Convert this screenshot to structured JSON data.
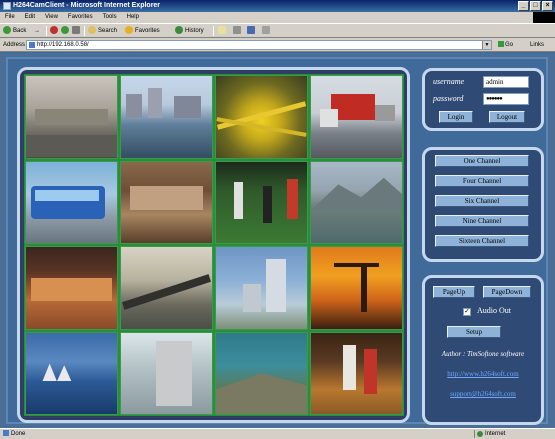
{
  "window": {
    "title": "H264CamClient - Microsoft Internet Explorer",
    "min": "_",
    "max": "□",
    "close": "×"
  },
  "menu": [
    "File",
    "Edit",
    "View",
    "Favorites",
    "Tools",
    "Help"
  ],
  "toolbar": {
    "back": "Back",
    "forward": "→",
    "search": "Search",
    "favorites": "Favorites",
    "history": "History"
  },
  "address": {
    "label": "Address",
    "url": "http://192.168.0.58/",
    "go": "Go",
    "links": "Links"
  },
  "login": {
    "username_label": "username",
    "username_value": "admin",
    "password_label": "password",
    "password_value": "●●●●●●",
    "login_button": "Login",
    "logout_button": "Logout"
  },
  "channels": [
    "One Channel",
    "Four Channel",
    "Six Channel",
    "Nine Channel",
    "Sixteen Channel"
  ],
  "controls": {
    "pageup": "PageUp",
    "pagedown": "PageDown",
    "audio_out": "Audio Out",
    "audio_checked": "✓",
    "setup": "Setup"
  },
  "footer": {
    "author": "Author : TimSoftone software",
    "website": "http://www.h264soft.com",
    "email": "support@h264soft.com"
  },
  "status": {
    "left": "Done",
    "zone": "Internet"
  },
  "colors": {
    "panel_border": "#c6d8ee",
    "grid_border": "#2a8d3c",
    "button": "#8fb2d8",
    "background": "#3f6a99"
  },
  "video_cells": [
    "rooftops",
    "harbor-city",
    "highway-interchange",
    "cargo-truck",
    "tour-bus",
    "rooftop-hall",
    "soccer-match",
    "mountain-lake",
    "cheerleaders",
    "railway-bridge",
    "skyscrapers",
    "sunset-crane",
    "opera-house",
    "apartment-blocks",
    "aerial-peninsula",
    "basketball"
  ]
}
